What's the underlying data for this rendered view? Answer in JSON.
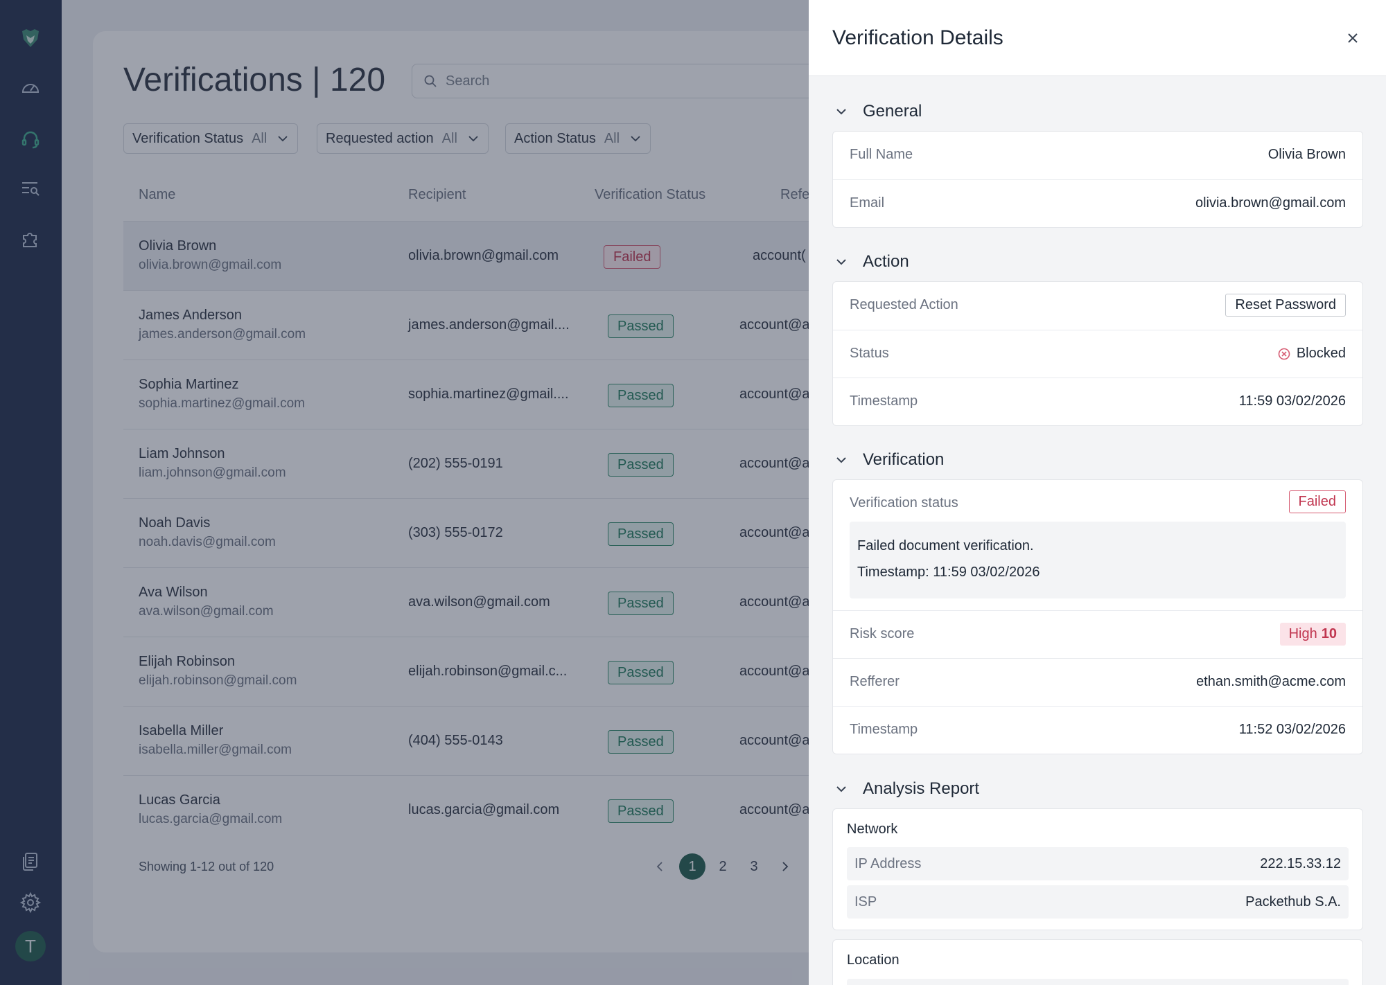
{
  "colors": {
    "sidebar_bg": "#1f2d4a",
    "accent": "#1f5c4c",
    "passed": "#1e7a5a",
    "failed": "#c0354f"
  },
  "sidebar": {
    "icons": [
      "logo-icon",
      "dashboard-gauge-icon",
      "headset-icon",
      "list-search-icon",
      "puzzle-icon",
      "documents-icon",
      "settings-gear-icon"
    ],
    "avatar_letter": "T"
  },
  "header": {
    "title": "Verifications | 120",
    "search_placeholder": "Search"
  },
  "filters": [
    {
      "label": "Verification Status",
      "value": "All"
    },
    {
      "label": "Requested action",
      "value": "All"
    },
    {
      "label": "Action Status",
      "value": "All"
    }
  ],
  "table": {
    "columns": [
      "Name",
      "Recipient",
      "Verification Status",
      "Refe"
    ],
    "rows": [
      {
        "name": "Olivia Brown",
        "email": "olivia.brown@gmail.com",
        "recipient": "olivia.brown@gmail.com",
        "status": "Failed",
        "referrer": "account("
      },
      {
        "name": "James Anderson",
        "email": "james.anderson@gmail.com",
        "recipient": "james.anderson@gmail....",
        "status": "Passed",
        "referrer": "account@a"
      },
      {
        "name": "Sophia Martinez",
        "email": "sophia.martinez@gmail.com",
        "recipient": "sophia.martinez@gmail....",
        "status": "Passed",
        "referrer": "account@a"
      },
      {
        "name": "Liam Johnson",
        "email": "liam.johnson@gmail.com",
        "recipient": "(202) 555-0191",
        "status": "Passed",
        "referrer": "account@a"
      },
      {
        "name": "Noah Davis",
        "email": "noah.davis@gmail.com",
        "recipient": "(303) 555-0172",
        "status": "Passed",
        "referrer": "account@a"
      },
      {
        "name": "Ava Wilson",
        "email": "ava.wilson@gmail.com",
        "recipient": "ava.wilson@gmail.com",
        "status": "Passed",
        "referrer": "account@a"
      },
      {
        "name": "Elijah Robinson",
        "email": "elijah.robinson@gmail.com",
        "recipient": "elijah.robinson@gmail.c...",
        "status": "Passed",
        "referrer": "account@a"
      },
      {
        "name": "Isabella Miller",
        "email": "isabella.miller@gmail.com",
        "recipient": "(404) 555-0143",
        "status": "Passed",
        "referrer": "account@a"
      },
      {
        "name": "Lucas Garcia",
        "email": "lucas.garcia@gmail.com",
        "recipient": "lucas.garcia@gmail.com",
        "status": "Passed",
        "referrer": "account@a"
      }
    ]
  },
  "pagination": {
    "showing": "Showing 1-12 out of 120",
    "pages": [
      "1",
      "2",
      "3"
    ],
    "active": "1"
  },
  "drawer": {
    "title": "Verification Details",
    "general": {
      "heading": "General",
      "full_name_label": "Full Name",
      "full_name": "Olivia Brown",
      "email_label": "Email",
      "email": "olivia.brown@gmail.com"
    },
    "action": {
      "heading": "Action",
      "requested_label": "Requested Action",
      "requested": "Reset Password",
      "status_label": "Status",
      "status": "Blocked",
      "timestamp_label": "Timestamp",
      "timestamp": "11:59 03/02/2026"
    },
    "verification": {
      "heading": "Verification",
      "status_label": "Verification status",
      "status": "Failed",
      "note_line1": "Failed document verification.",
      "note_line2": "Timestamp: 11:59 03/02/2026",
      "risk_label": "Risk score",
      "risk_level": "High",
      "risk_value": "10",
      "referrer_label": "Refferer",
      "referrer": "ethan.smith@acme.com",
      "timestamp_label": "Timestamp",
      "timestamp": "11:52 03/02/2026"
    },
    "analysis": {
      "heading": "Analysis Report",
      "network_title": "Network",
      "ip_label": "IP Address",
      "ip": "222.15.33.12",
      "isp_label": "ISP",
      "isp": "Packethub S.A.",
      "location_title": "Location"
    }
  }
}
